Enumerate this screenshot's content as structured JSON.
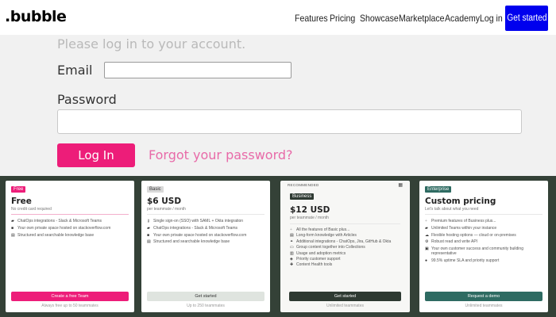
{
  "header": {
    "logo": ".bubble",
    "nav": [
      "Features",
      "Pricing",
      "Showcase",
      "Marketplace",
      "Academy",
      "Log in"
    ],
    "cta": "Get started"
  },
  "login": {
    "prompt": "Please log in to your account.",
    "email_label": "Email",
    "email_value": "",
    "password_label": "Password",
    "password_value": "",
    "login_button": "Log In",
    "forgot_link": "Forgot your password?",
    "button_color": "#ed1d79"
  },
  "pricing": {
    "background_color": "#344137",
    "cards": [
      {
        "badge": "Free",
        "price": "Free",
        "sub": "No credit card required",
        "features": [
          "ChatOps integrations - Slack & Microsoft Teams",
          "Your own private space hosted on stackoverflow.com",
          "Structured and searchable knowledge base"
        ],
        "button": "Create a free Team",
        "footnote": "Always free up to 50 teammates"
      },
      {
        "badge": "Basic",
        "price": "$6 USD",
        "sub": "per teammate / month",
        "features": [
          "Single sign-on (SSO) with SAML + Okta integration",
          "ChatOps integrations - Slack & Microsoft Teams",
          "Your own private space hosted on stackoverflow.com",
          "Structured and searchable knowledge base"
        ],
        "button": "Get started",
        "footnote": "Up to 250 teammates"
      },
      {
        "recommended": "RECOMMENDED",
        "badge": "Business",
        "price": "$12 USD",
        "sub": "per teammate / month",
        "features": [
          "All the features of Basic plus...",
          "Long-form knowledge with Articles",
          "Additional integrations - ChatOps, Jira, GitHub & Okta",
          "Group content together into Collections",
          "Usage and adoption metrics",
          "Priority customer support",
          "Content Health tools"
        ],
        "button": "Get started",
        "footnote": "Unlimited teammates"
      },
      {
        "badge": "Enterprise",
        "price": "Custom pricing",
        "sub": "Let's talk about what you need",
        "features": [
          "Premium features of Business plus...",
          "Unlimited Teams within your instance",
          "Flexible hosting options — cloud or on-premises",
          "Robust read and write API",
          "Your own customer success and community building representative",
          "99.5% uptime SLA and priority support"
        ],
        "button": "Request a demo",
        "footnote": "Unlimited teammates"
      }
    ]
  }
}
